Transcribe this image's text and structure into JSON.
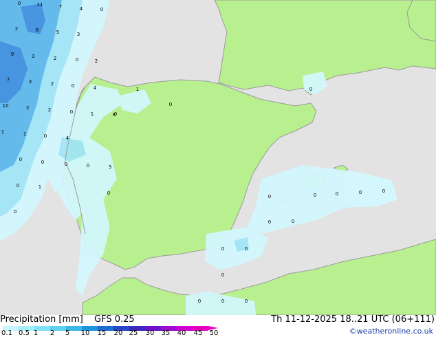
{
  "footer": {
    "title": "Precipitation [mm]",
    "model": "GFS 0.25",
    "valid": "Th 11-12-2025 18..21 UTC (06+111)",
    "credit": "©weatheronline.co.uk"
  },
  "legend": {
    "ticks": [
      "0.1",
      "0.5",
      "1",
      "2",
      "5",
      "10",
      "15",
      "20",
      "25",
      "30",
      "35",
      "40",
      "45",
      "50"
    ],
    "colors": [
      "#c8f6ff",
      "#a6eefa",
      "#82e2f5",
      "#5fd0ee",
      "#3cb9e6",
      "#1e96dc",
      "#1e6ed2",
      "#2846c8",
      "#3c28be",
      "#6e14c8",
      "#a00ad2",
      "#d200d2",
      "#e600be"
    ]
  },
  "colors": {
    "land": "#b9f08f",
    "sea": "#e3e3e3",
    "border": "#9a9a9a",
    "precip_light": "#d2f8ff",
    "precip_mid": "#a0e6f8",
    "precip_high": "#5ab8ec",
    "precip_heavy": "#3a8ee0"
  },
  "labels": [
    "0",
    "11",
    "7",
    "4",
    "0",
    "2",
    "8",
    "5",
    "3",
    "9",
    "3",
    "2",
    "0",
    "2",
    "7",
    "3",
    "2",
    "0",
    "4",
    "10",
    "3",
    "2",
    "0",
    "1",
    "8",
    "1",
    "1",
    "0",
    "4",
    "1",
    "0",
    "0",
    "0",
    "0",
    "3",
    "0",
    "1",
    "0",
    "0",
    "0",
    "0",
    "0",
    "0",
    "0",
    "0",
    "0",
    "0",
    "0",
    "0",
    "0",
    "0",
    "0",
    "0",
    "0",
    "0"
  ]
}
